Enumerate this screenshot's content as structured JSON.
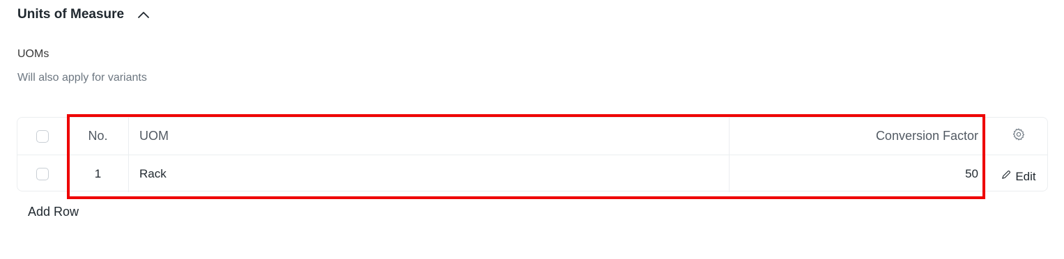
{
  "section": {
    "title": "Units of Measure",
    "collapse_icon": "chevron-up-icon"
  },
  "field": {
    "label": "UOMs",
    "description": "Will also apply for variants"
  },
  "table": {
    "columns": {
      "no": "No.",
      "uom": "UOM",
      "conversion_factor": "Conversion Factor"
    },
    "settings_icon": "gear-icon",
    "rows": [
      {
        "no": "1",
        "uom": "Rack",
        "conversion_factor": "50",
        "edit_label": "Edit",
        "edit_icon": "pencil-icon"
      }
    ],
    "add_row_label": "Add Row"
  },
  "colors": {
    "highlight": "#ee0000",
    "border": "#ebeef0",
    "text": "#1f272e",
    "muted": "#6c7680"
  }
}
